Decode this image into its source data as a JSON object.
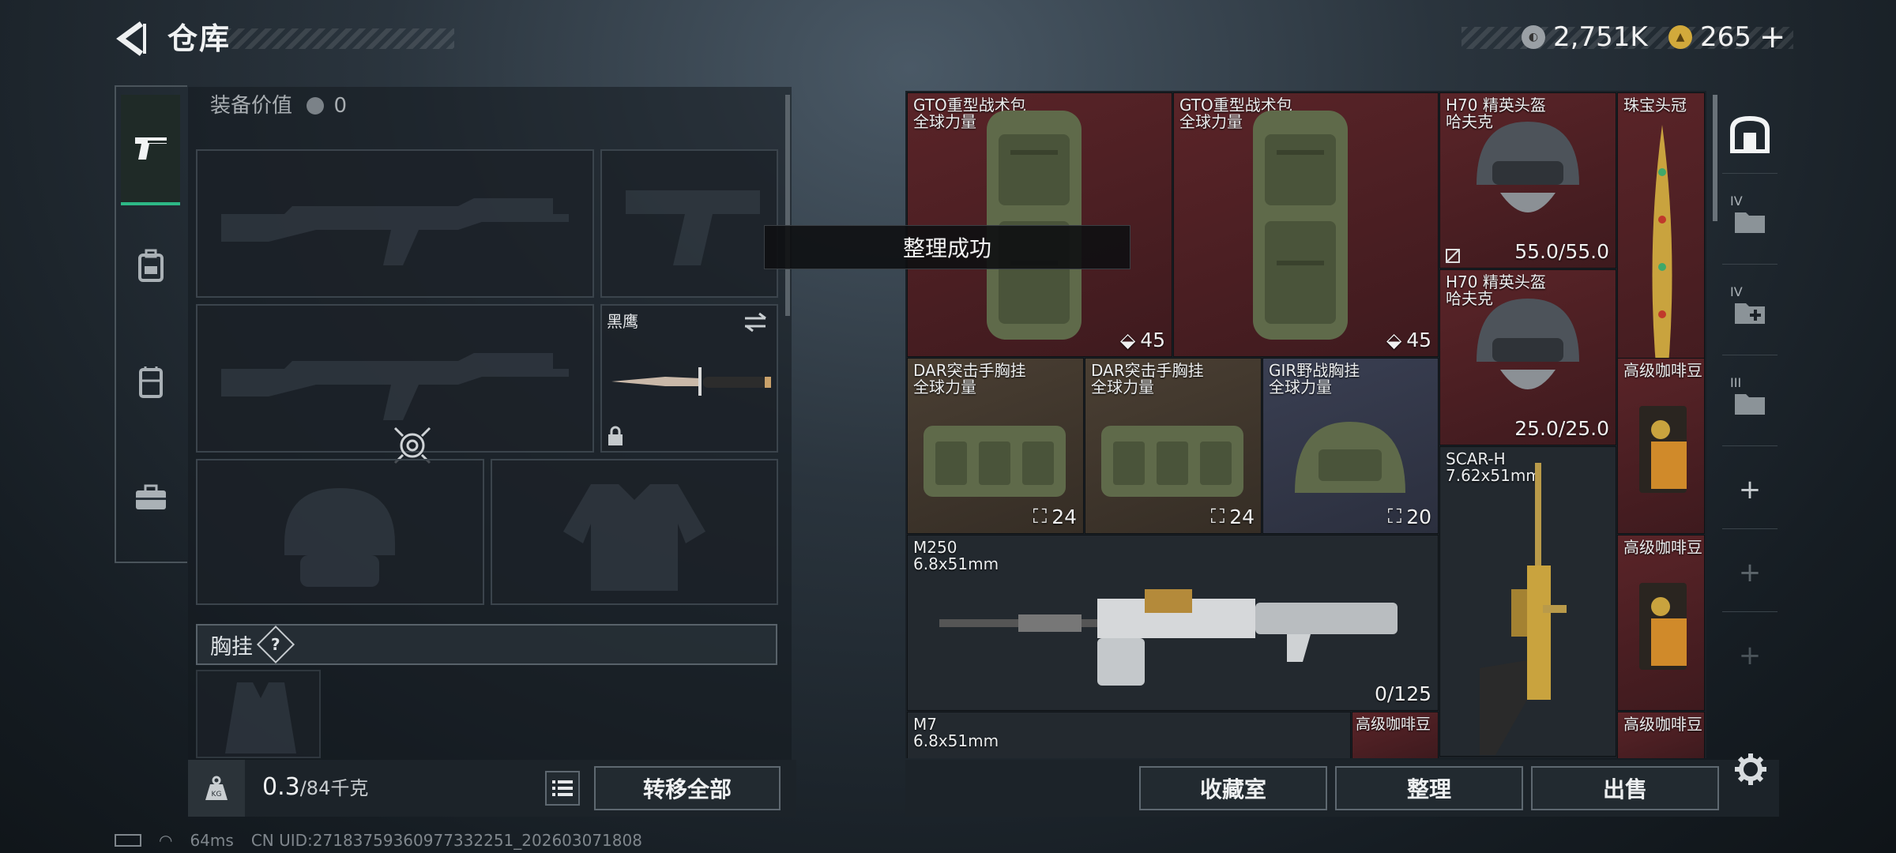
{
  "header": {
    "title": "仓库",
    "currency_silver": "2,751K",
    "currency_gold": "265",
    "gold_add": "+"
  },
  "equipment": {
    "value_label": "装备价值",
    "value": "0",
    "knife_name": "黑鹰",
    "chest_rig_label": "胸挂",
    "chest_rig_help": "?",
    "weight_current": "0.3",
    "weight_max": "/84千克",
    "transfer_all": "转移全部"
  },
  "toast": "整理成功",
  "items": [
    {
      "name": "GTO重型战术包",
      "sub": "全球力量",
      "count": "45"
    },
    {
      "name": "GTO重型战术包",
      "sub": "全球力量",
      "count": "45"
    },
    {
      "name": "H70 精英头盔",
      "sub": "哈夫克",
      "count": "55.0/55.0"
    },
    {
      "name": "珠宝头冠"
    },
    {
      "name": "H70 精英头盔",
      "sub": "哈夫克",
      "count": "25.0/25.0"
    },
    {
      "name": "DAR突击手胸挂",
      "sub": "全球力量",
      "count": "24"
    },
    {
      "name": "DAR突击手胸挂",
      "sub": "全球力量",
      "count": "24"
    },
    {
      "name": "GIR野战胸挂",
      "sub": "全球力量",
      "count": "20"
    },
    {
      "name": "高级咖啡豆"
    },
    {
      "name": "SCAR-H",
      "sub": "7.62x51mm"
    },
    {
      "name": "M250",
      "sub": "6.8x51mm",
      "count": "0/125"
    },
    {
      "name": "高级咖啡豆"
    },
    {
      "name": "M7",
      "sub": "6.8x51mm"
    },
    {
      "name": "高级咖啡豆"
    },
    {
      "name": "高级咖啡豆"
    }
  ],
  "bottom_buttons": {
    "collection": "收藏室",
    "sort": "整理",
    "sell": "出售"
  },
  "right_tabs": [
    {
      "icon": "safe-box-icon"
    },
    {
      "icon": "folder-tier4-icon",
      "tier": "IV"
    },
    {
      "icon": "add-box-tier4-icon",
      "tier": "IV"
    },
    {
      "icon": "box-tier3-icon",
      "tier": "III"
    },
    {
      "icon": "plus-icon",
      "label": "+"
    },
    {
      "icon": "plus-icon-dim",
      "label": "+"
    },
    {
      "icon": "plus-icon-dim2",
      "label": "+"
    }
  ],
  "status": {
    "ping": "64ms",
    "uid": "CN UID:271837593609773322​51_202603071808"
  },
  "colors": {
    "accent": "#2db886",
    "rare_red": "#5a2428",
    "epic_brown": "#4a3f33",
    "blue": "#3a3f52"
  }
}
